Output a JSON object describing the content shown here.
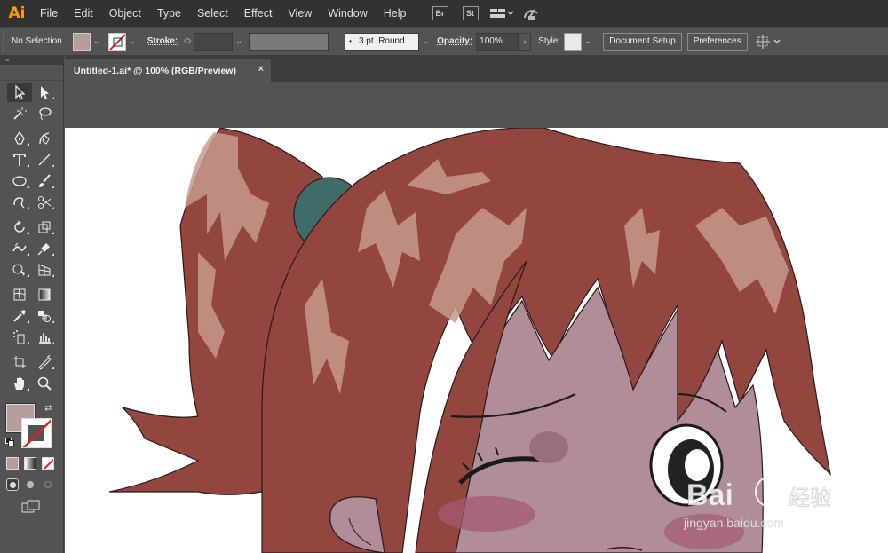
{
  "app": {
    "logo": "Ai"
  },
  "menu": [
    "File",
    "Edit",
    "Object",
    "Type",
    "Select",
    "Effect",
    "View",
    "Window",
    "Help"
  ],
  "app_badges": [
    "Br",
    "St"
  ],
  "control": {
    "selection_label": "No Selection",
    "fill_color": "#b49d9a",
    "stroke_label": "Stroke:",
    "brush_label": "3 pt. Round",
    "opacity_label": "Opacity:",
    "opacity_value": "100%",
    "style_label": "Style:",
    "document_setup": "Document Setup",
    "preferences": "Preferences"
  },
  "tools_collapse": "«",
  "document": {
    "tab_title": "Untitled-1.ai* @ 100% (RGB/Preview)",
    "close_glyph": "×"
  },
  "tools_panel": {
    "fill_color": "#b49d9a",
    "stroke_color": "none"
  },
  "artwork": {
    "hair_color": "#93453f",
    "highlight_color": "#c79a8c",
    "skin_color": "#b08d98",
    "hair_tie_color": "#3f6b68",
    "blush_color": "#a65a72",
    "watermark_text": "Bai",
    "watermark_cn": "经验",
    "watermark_url": "jingyan.baidu.com"
  }
}
